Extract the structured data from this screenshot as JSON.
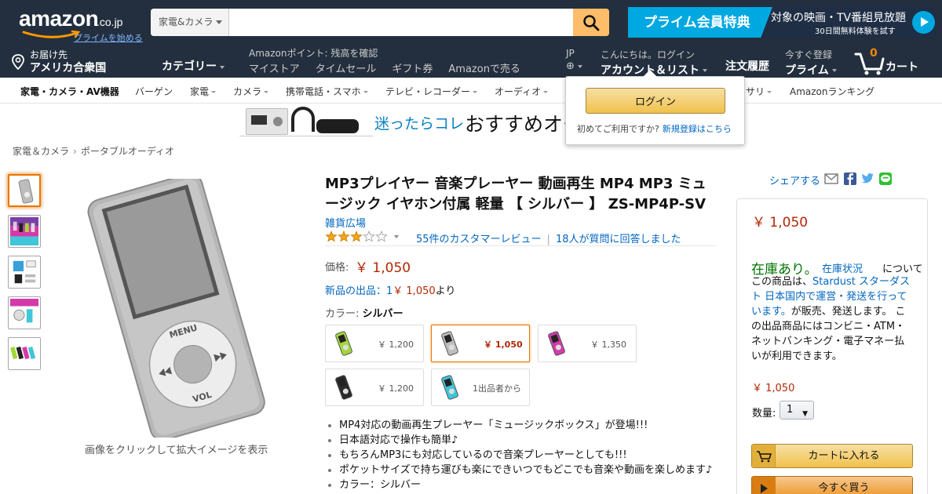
{
  "header": {
    "logo": {
      "word": "amazon",
      "tld": ".co.jp",
      "prime_link": "プライムを始める"
    },
    "search": {
      "category": "家電&カメラ",
      "placeholder": "",
      "value": ""
    },
    "prime_banner": {
      "title": "プライム会員特典",
      "message": "対象の映画・TV番組見放題",
      "sub": "30日間無料体験を試す"
    }
  },
  "nav": {
    "deliver": {
      "small": "お届け先",
      "big": "アメリカ合衆国"
    },
    "category_menu": "カテゴリー",
    "points": "Amazonポイント: 残高を確認",
    "links": [
      "マイストア",
      "タイムセール",
      "ギフト券",
      "Amazonで売る"
    ],
    "lang": "JP",
    "account": {
      "small": "こんにちは。ログイン",
      "big": "アカウント＆リスト"
    },
    "orders": "注文履歴",
    "prime": {
      "small": "今すぐ登録",
      "big": "プライム"
    },
    "cart": {
      "count": "0",
      "label": "カート"
    }
  },
  "subnav": [
    "家電・カメラ・AV機器",
    "バーゲン",
    "家電",
    "カメラ",
    "携帯電話・スマホ",
    "テレビ・レコーダー",
    "オーディオ",
    "サリ",
    "Amazonランキング"
  ],
  "ad": {
    "text1": "迷ったらコレ",
    "text2": "おすすめオー"
  },
  "popover": {
    "login": "ログイン",
    "first_time": "初めてご利用ですか?",
    "register": "新規登録はこちら"
  },
  "breadcrumb": [
    "家電＆カメラ",
    "ポータブルオーディオ"
  ],
  "product": {
    "title": "MP3プレイヤー 音楽プレーヤー 動画再生 MP4 MP3 ミュージック イヤホン付属 軽量 【 シルバー 】 ZS-MP4P-SV",
    "brand": "雑貨広場",
    "rating": 3.0,
    "reviews": "55件のカスタマーレビュー",
    "answered": "18人が質問に回答しました",
    "price_label": "価格:",
    "price": "￥ 1,050",
    "new_offers": {
      "label": "新品の出品：1",
      "price": "￥ 1,050",
      "suffix": "より"
    },
    "color_label": "カラー:",
    "color_value": "シルバー",
    "device_labels": {
      "menu": "MENU",
      "vol": "VOL"
    },
    "image_caption": "画像をクリックして拡大イメージを表示",
    "swatches": [
      {
        "price": "￥ 1,200",
        "color": "#a4d83a"
      },
      {
        "price": "￥ 1,050",
        "color": "#bdbdbd"
      },
      {
        "price": "￥ 1,350",
        "color": "#d43aa8"
      },
      {
        "price": "￥ 1,200",
        "color": "#2a2a2a"
      },
      {
        "price": "1出品者から",
        "color": "#3fc6d8"
      }
    ],
    "bullets": [
      "MP4対応の動画再生プレーヤー「ミュージックボックス」が登場!!!",
      "日本語対応で操作も簡単♪",
      "もちろんMP3にも対応しているので音楽プレーヤーとしても!!!",
      "ポケットサイズで持ち運びも楽にできいつでもどこでも音楽や動画を楽しめます♪",
      "カラー：シルバー"
    ]
  },
  "share": {
    "label": "シェアする"
  },
  "buybox": {
    "price": "￥ 1,050",
    "stock": "在庫あり。",
    "stock_link": "在庫状況",
    "about": "について",
    "desc_pre": "この商品は、",
    "seller": "Stardust スターダスト 日本国内で運営・発送を行っています。",
    "desc_post": "が販売、発送します。 この出品商品にはコンビニ・ATM・ネットバンキング・電子マネー払いが利用できます。",
    "price2": "￥ 1,050",
    "qty_label": "数量:",
    "qty": "1",
    "add_to_cart": "カートに入れる",
    "buy_now": "今すぐ買う"
  },
  "colors": {
    "nav_bg": "#232f3e",
    "search_btn": "#febd69",
    "prime_blue": "#00a8e1",
    "price_red": "#b12704",
    "link_blue": "#0066c0",
    "in_stock_green": "#007600",
    "star_gold": "#f4a41d"
  }
}
